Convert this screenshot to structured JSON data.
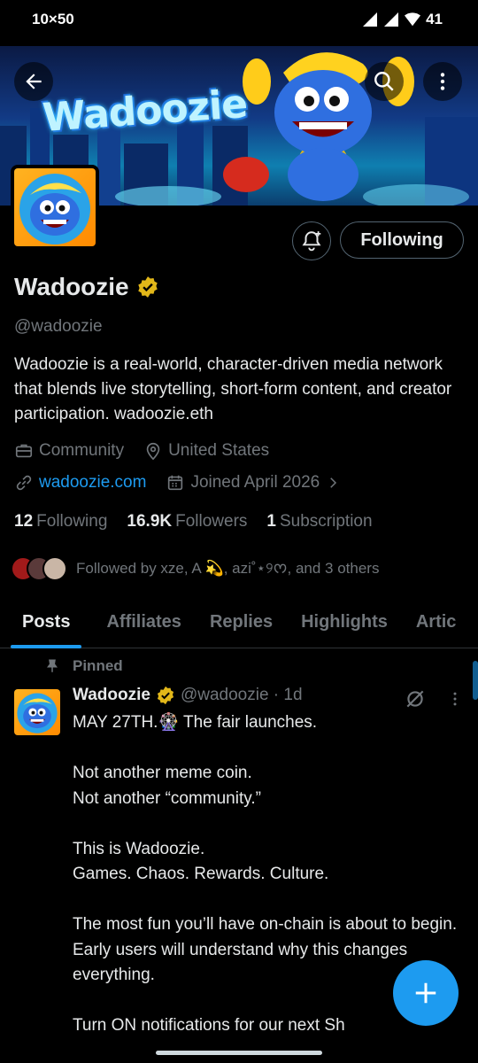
{
  "status_bar": {
    "time": "10×50",
    "battery": "41"
  },
  "banner": {
    "logo_text": "Wadoozie"
  },
  "actions": {
    "follow_label": "Following"
  },
  "profile": {
    "name": "Wadoozie",
    "handle": "@wadoozie",
    "bio": "Wadoozie is a real-world, character-driven media network that blends live storytelling, short-form content, and creator participation. wadoozie.eth",
    "category": "Community",
    "location": "United States",
    "website": "wadoozie.com",
    "joined": "Joined April 2026"
  },
  "counts": {
    "following_num": "12",
    "following_label": "Following",
    "followers_num": "16.9K",
    "followers_label": "Followers",
    "subs_num": "1",
    "subs_label": "Subscription"
  },
  "followed_by": "Followed by xze, A 💫, azi˚⋆୨ᰔ, and 3 others",
  "tabs": [
    "Posts",
    "Affiliates",
    "Replies",
    "Highlights",
    "Artic"
  ],
  "post": {
    "pinned_label": "Pinned",
    "author": "Wadoozie",
    "meta": "@wadoozie · 1d",
    "body": "MAY 27TH.🎡 The fair launches.\n\nNot another meme coin.\nNot another “community.”\n\nThis is Wadoozie.\nGames. Chaos. Rewards. Culture.\n\nThe most fun you’ll have on-chain is about to begin.\nEarly users will understand why this changes everything.\n\nTurn ON notifications for our next Sh"
  },
  "colors": {
    "accent": "#1d9bf0",
    "verified": "#e2b719",
    "muted": "#71767b"
  }
}
